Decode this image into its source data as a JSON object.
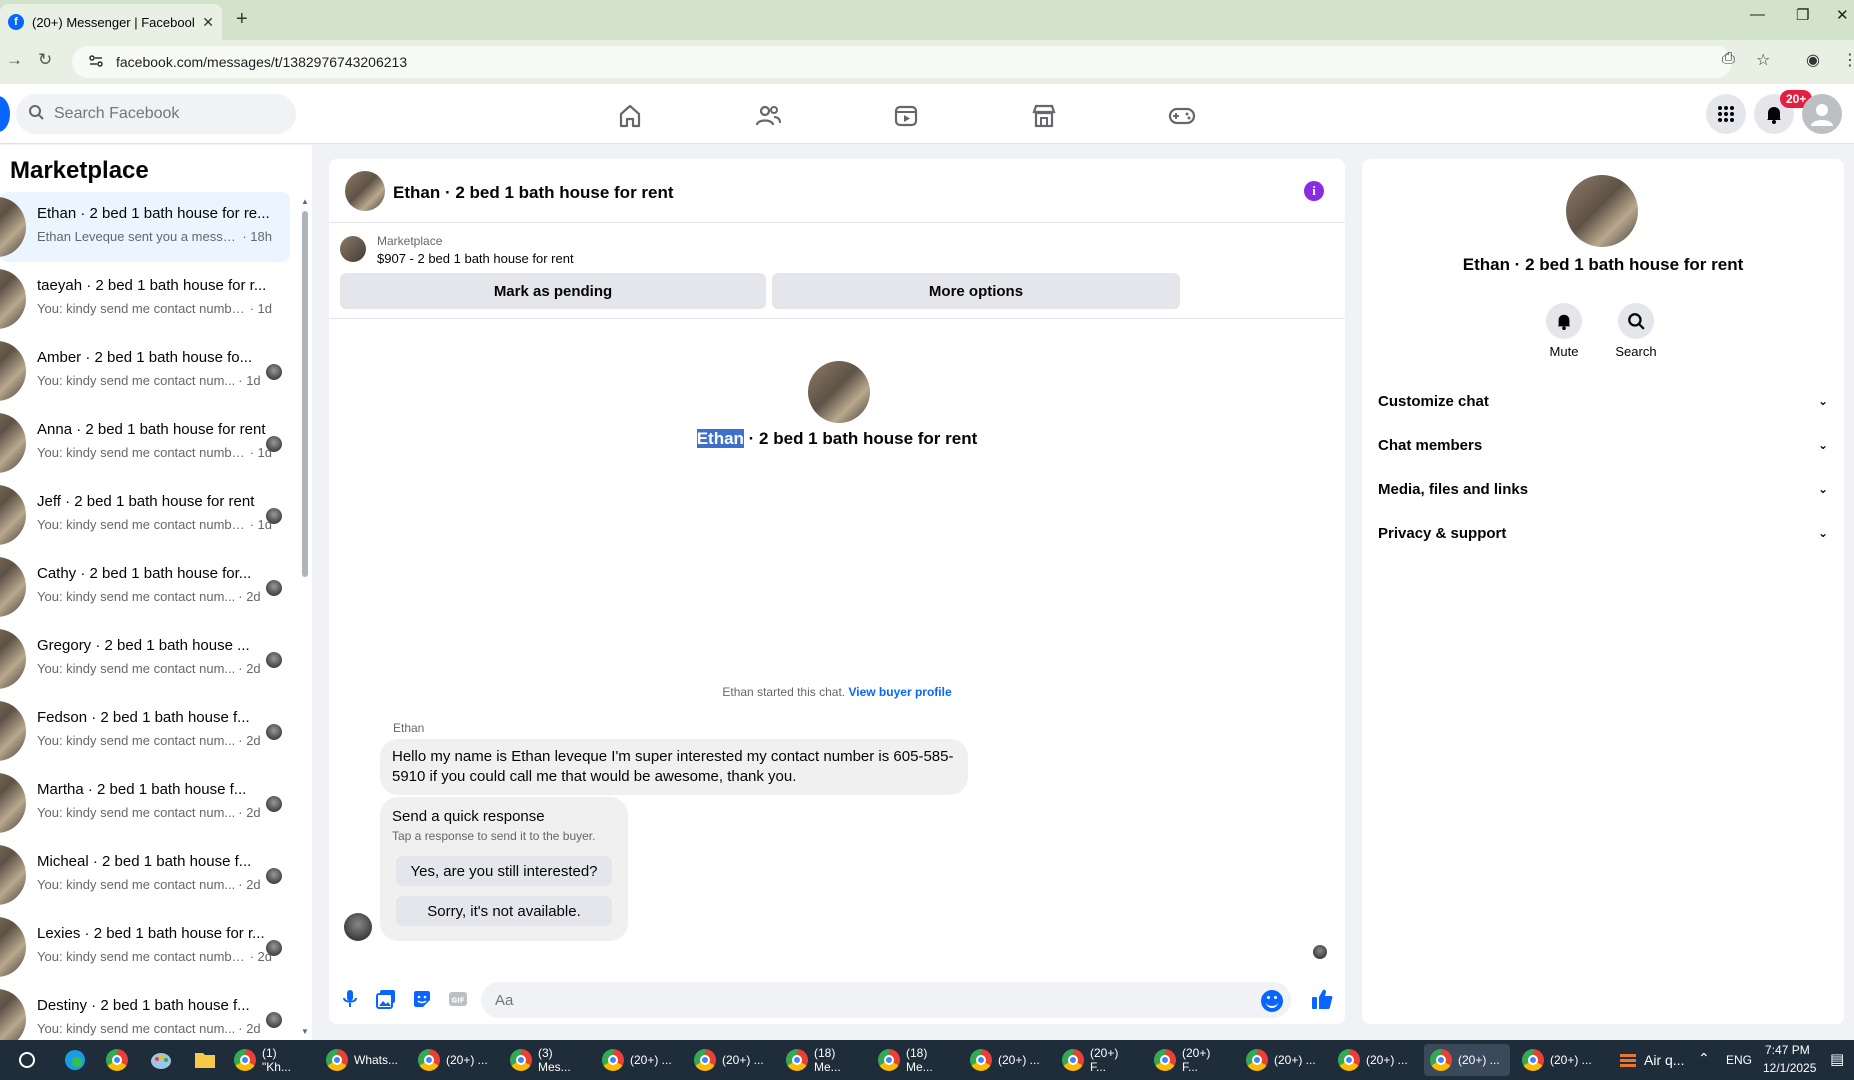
{
  "browser": {
    "tab_title": "(20+) Messenger | Facebook",
    "favicon_letter": "f",
    "url": "facebook.com/messages/t/1382976743206213"
  },
  "header": {
    "search_placeholder": "Search Facebook",
    "notification_badge": "20+"
  },
  "sidebar": {
    "title": "Marketplace",
    "conversations": [
      {
        "name": "Ethan · 2 bed 1 bath house for re...",
        "preview": "Ethan Leveque sent you a messag...",
        "time": "· 18h",
        "active": true
      },
      {
        "name": "taeyah · 2 bed 1 bath house for r...",
        "preview": "You: kindy send me contact numbe...",
        "time": "· 1d"
      },
      {
        "name": "Amber · 2 bed 1 bath house fo...",
        "preview": "You: kindy send me contact num...",
        "time": "· 1d"
      },
      {
        "name": "Anna · 2 bed 1 bath house for rent",
        "preview": "You: kindy send me contact numbe...",
        "time": "· 1d"
      },
      {
        "name": "Jeff · 2 bed 1 bath house for rent",
        "preview": "You: kindy send me contact numbe...",
        "time": "· 1d"
      },
      {
        "name": "Cathy · 2 bed 1 bath house for...",
        "preview": "You: kindy send me contact num...",
        "time": "· 2d"
      },
      {
        "name": "Gregory · 2 bed 1 bath house ...",
        "preview": "You: kindy send me contact num...",
        "time": "· 2d"
      },
      {
        "name": "Fedson · 2 bed 1 bath house f...",
        "preview": "You: kindy send me contact num...",
        "time": "· 2d"
      },
      {
        "name": "Martha · 2 bed 1 bath house f...",
        "preview": "You: kindy send me contact num...",
        "time": "· 2d"
      },
      {
        "name": "Micheal · 2 bed 1 bath house f...",
        "preview": "You: kindy send me contact num...",
        "time": "· 2d"
      },
      {
        "name": "Lexies · 2 bed 1 bath house for r...",
        "preview": "You: kindy send me contact numbe...",
        "time": "· 2d"
      },
      {
        "name": "Destiny · 2 bed 1 bath house f...",
        "preview": "You: kindy send me contact num...",
        "time": "· 2d"
      }
    ]
  },
  "chat": {
    "title": "Ethan · 2 bed 1 bath house for rent",
    "marketplace_label": "Marketplace",
    "listing": "$907 - 2 bed 1 bath house for rent",
    "pending_button": "Mark as pending",
    "more_button": "More options",
    "center_name": "Ethan",
    "center_rest": " · 2 bed 1 bath house for rent",
    "started_text": "Ethan started this chat.",
    "buyer_profile_link": "View buyer profile",
    "sender": "Ethan",
    "message": "Hello my name is Ethan leveque I'm super interested my contact number is 605-585-5910 if you could call me that would be awesome, thank you.",
    "quick_title": "Send a quick response",
    "quick_subtitle": "Tap a response to send it to the buyer.",
    "quick_reply_1": "Yes, are you still interested?",
    "quick_reply_2": "Sorry, it's not available.",
    "composer_placeholder": "Aa"
  },
  "details": {
    "title": "Ethan · 2 bed 1 bath house for rent",
    "mute_label": "Mute",
    "search_label": "Search",
    "sections": [
      "Customize chat",
      "Chat members",
      "Media, files and links",
      "Privacy & support"
    ]
  },
  "taskbar": {
    "items": [
      "(1) \"Kh...",
      "Whats...",
      "(20+) ...",
      "(3) Mes...",
      "(20+) ...",
      "(20+) ...",
      "(18) Me...",
      "(18) Me...",
      "(20+) ...",
      "(20+) F...",
      "(20+) F...",
      "(20+) ...",
      "(20+) ...",
      "(20+) ...",
      "(20+) ..."
    ],
    "weather": "Air q...",
    "lang": "ENG",
    "time": "7:47 PM",
    "date": "12/1/2025"
  },
  "colors": {
    "fb_blue": "#0866ff",
    "badge_red": "#e41e3f",
    "info_purple": "#8a2be2",
    "chrome_bg": "#d3e3cb"
  }
}
